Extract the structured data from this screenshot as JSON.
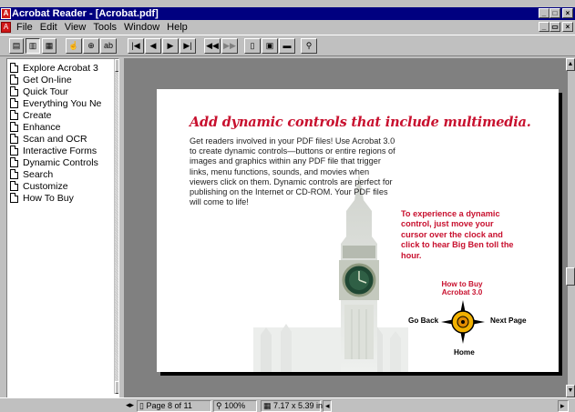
{
  "window": {
    "title": "Acrobat Reader - [Acrobat.pdf]"
  },
  "menubar": {
    "items": [
      "File",
      "Edit",
      "View",
      "Tools",
      "Window",
      "Help"
    ]
  },
  "bookmarks": [
    "Explore Acrobat 3",
    "Get On-line",
    "Quick Tour",
    "Everything You Ne",
    "Create",
    "Enhance",
    "Scan and OCR",
    "Interactive Forms",
    "Dynamic Controls",
    "Search",
    "Customize",
    "How To Buy"
  ],
  "page": {
    "headline": "Add dynamic controls that include multimedia.",
    "body": "Get readers involved in your PDF files! Use Acrobat 3.0 to create dynamic controls—buttons or entire regions of images and graphics within any PDF file that trigger links, menu functions, sounds, and movies when viewers click on them. Dynamic controls are perfect for publishing on the Internet or CD-ROM. Your PDF files will come to life!",
    "callout": "To experience a dynamic control, just move your cursor over the clock and click to hear Big Ben toll the hour.",
    "how_to_buy": "How to Buy Acrobat 3.0",
    "go_back": "Go Back",
    "next_page": "Next Page",
    "home": "Home"
  },
  "status": {
    "page": "Page 8 of 11",
    "zoom": "100%",
    "size": "7.17 x 5.39 in"
  }
}
